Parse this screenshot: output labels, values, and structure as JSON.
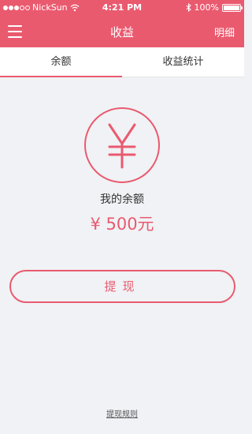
{
  "status_bar": {
    "carrier": "NickSun",
    "time": "4:21 PM",
    "battery": "100%"
  },
  "nav": {
    "title": "收益",
    "detail_label": "明细"
  },
  "tabs": [
    {
      "label": "余额",
      "active": true
    },
    {
      "label": "收益统计",
      "active": false
    }
  ],
  "balance": {
    "label": "我的余额",
    "amount": "¥ 500元"
  },
  "withdraw_button": "提现",
  "rules_link": "提现规则",
  "colors": {
    "accent": "#ea5a6f",
    "background": "#f0f2f5"
  }
}
